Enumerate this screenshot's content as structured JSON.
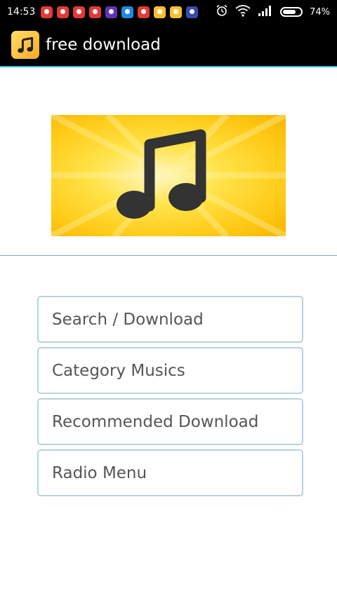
{
  "status_bar": {
    "time": "14:53",
    "battery_percent": "74%",
    "battery_level": 0.74,
    "icons": [
      "alarm-icon",
      "wifi-icon",
      "signal-icon",
      "battery-icon"
    ],
    "notification_icons": [
      "red",
      "red",
      "red",
      "red",
      "purple",
      "blue",
      "red",
      "yellow",
      "yellow",
      "dblue"
    ]
  },
  "app_bar": {
    "title": "free download",
    "icon": "music-note-icon",
    "accent_color": "#33b5e5"
  },
  "banner": {
    "icon": "music-note-icon",
    "background_color": "#ffd21f"
  },
  "menu": {
    "items": [
      {
        "label": "Search / Download"
      },
      {
        "label": "Category Musics"
      },
      {
        "label": "Recommended Download"
      },
      {
        "label": "Radio Menu"
      }
    ]
  }
}
